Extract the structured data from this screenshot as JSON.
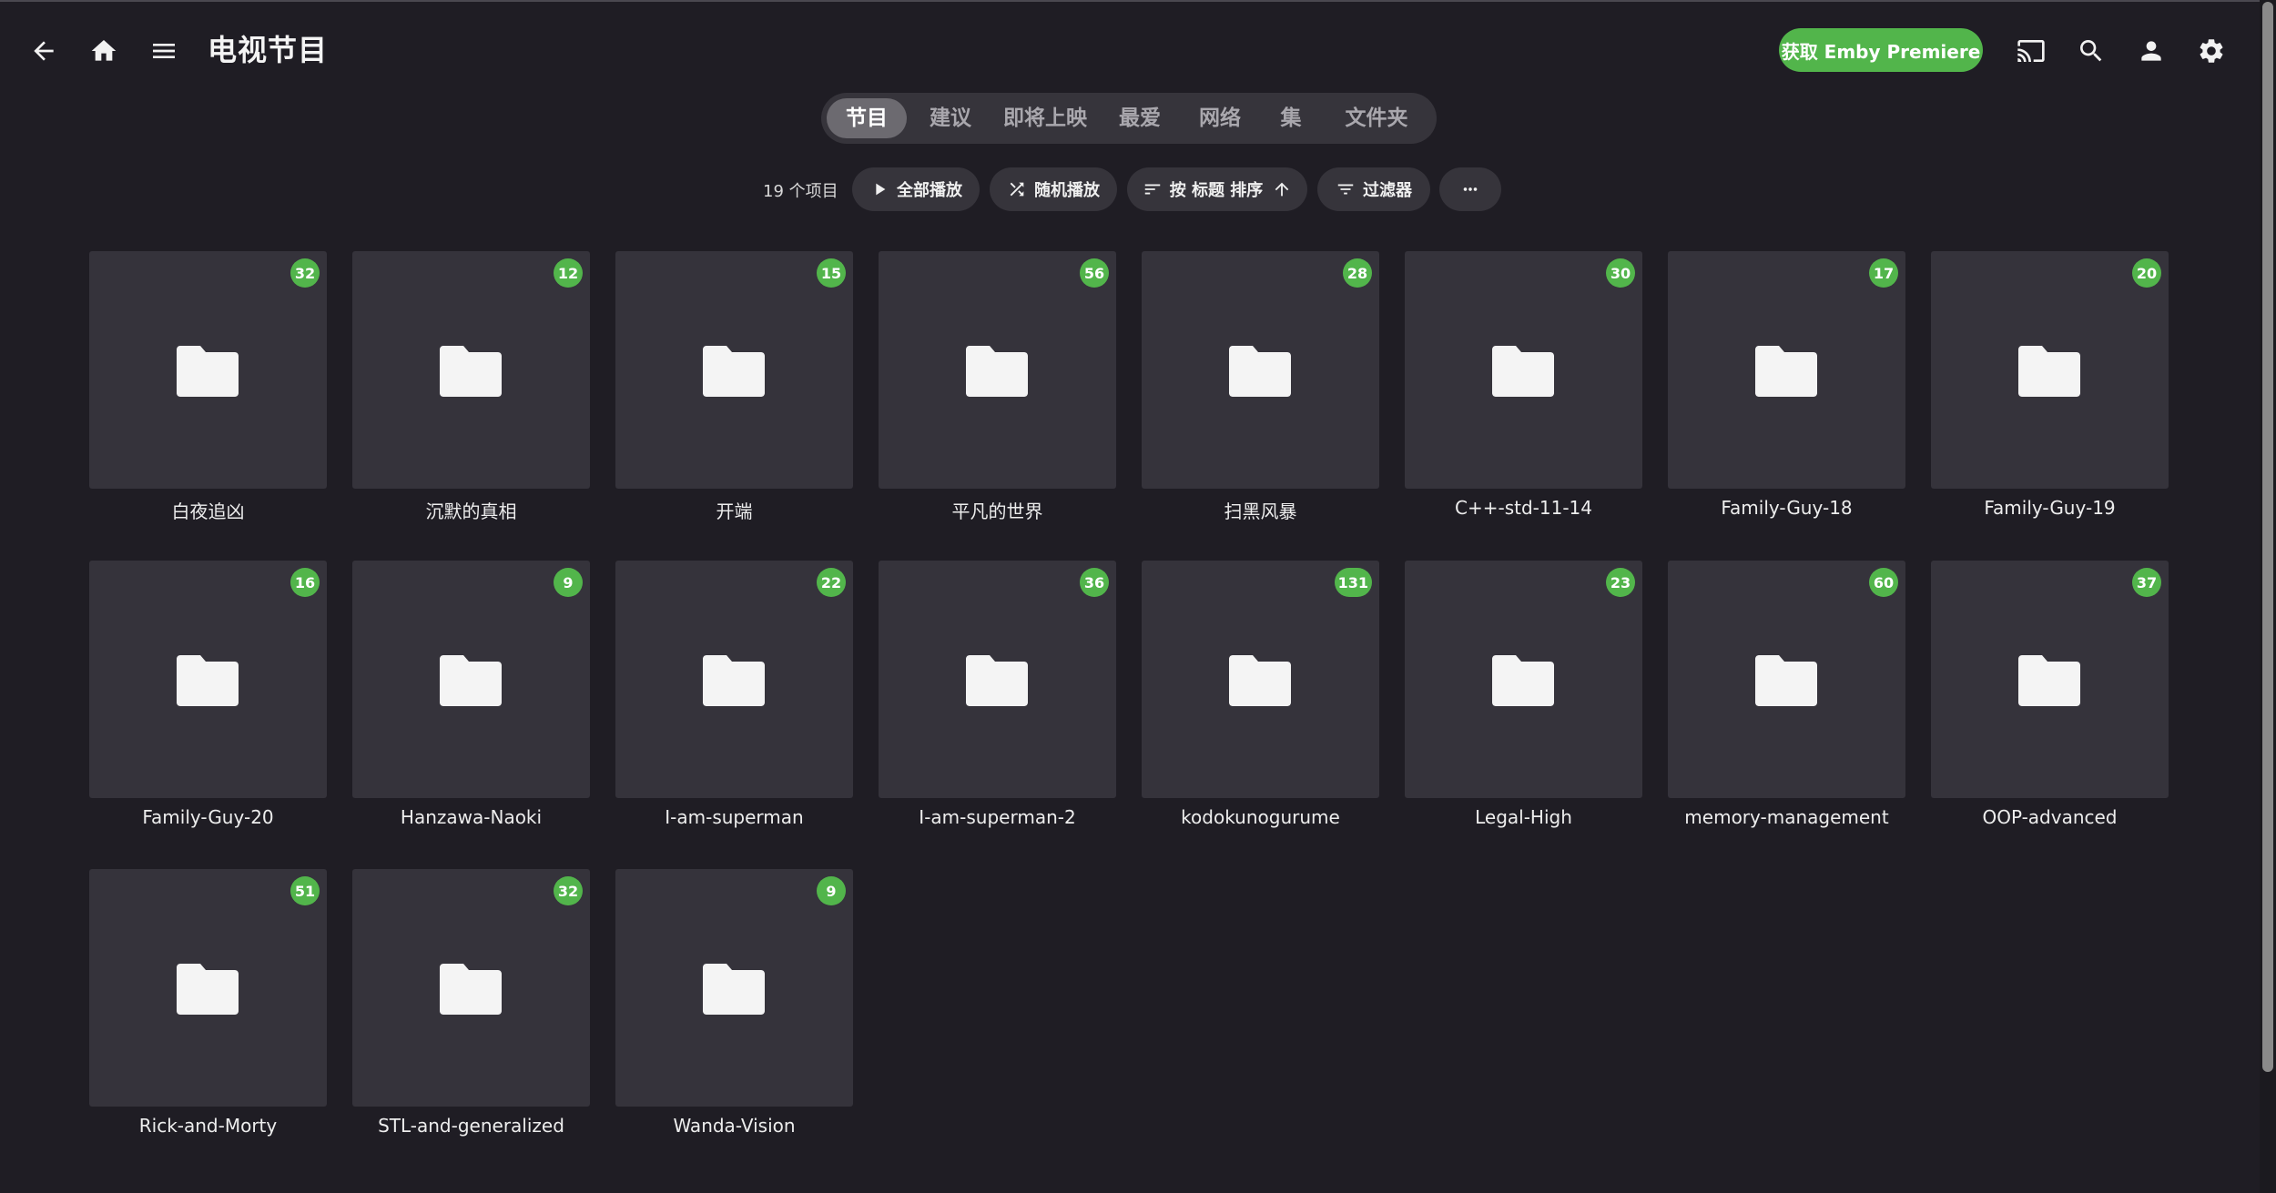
{
  "header": {
    "title": "电视节目",
    "premiere_label": "获取 Emby Premiere",
    "icons": [
      "back-arrow-icon",
      "home-icon",
      "menu-icon",
      "cast-icon",
      "search-icon",
      "user-icon",
      "settings-icon"
    ]
  },
  "tabs": [
    {
      "label": "节目",
      "active": true
    },
    {
      "label": "建议",
      "active": false
    },
    {
      "label": "即将上映",
      "active": false
    },
    {
      "label": "最爱",
      "active": false
    },
    {
      "label": "网络",
      "active": false
    },
    {
      "label": "集",
      "active": false
    },
    {
      "label": "文件夹",
      "active": false
    }
  ],
  "toolbar": {
    "count": "19 个项目",
    "play_all": "全部播放",
    "shuffle": "随机播放",
    "sort": "按 标题 排序",
    "filter": "过滤器"
  },
  "items": [
    {
      "name": "白夜追凶",
      "count": "32"
    },
    {
      "name": "沉默的真相",
      "count": "12"
    },
    {
      "name": "开端",
      "count": "15"
    },
    {
      "name": "平凡的世界",
      "count": "56"
    },
    {
      "name": "扫黑风暴",
      "count": "28"
    },
    {
      "name": "C++-std-11-14",
      "count": "30"
    },
    {
      "name": "Family-Guy-18",
      "count": "17"
    },
    {
      "name": "Family-Guy-19",
      "count": "20"
    },
    {
      "name": "Family-Guy-20",
      "count": "16"
    },
    {
      "name": "Hanzawa-Naoki",
      "count": "9"
    },
    {
      "name": "I-am-superman",
      "count": "22"
    },
    {
      "name": "I-am-superman-2",
      "count": "36"
    },
    {
      "name": "kodokunogurume",
      "count": "131"
    },
    {
      "name": "Legal-High",
      "count": "23"
    },
    {
      "name": "memory-management",
      "count": "60"
    },
    {
      "name": "OOP-advanced",
      "count": "37"
    },
    {
      "name": "Rick-and-Morty",
      "count": "51"
    },
    {
      "name": "STL-and-generalized",
      "count": "32"
    },
    {
      "name": "Wanda-Vision",
      "count": "9"
    }
  ],
  "colors": {
    "accent": "#52b54b",
    "background": "#1f1d24",
    "tile": "#35333b"
  }
}
